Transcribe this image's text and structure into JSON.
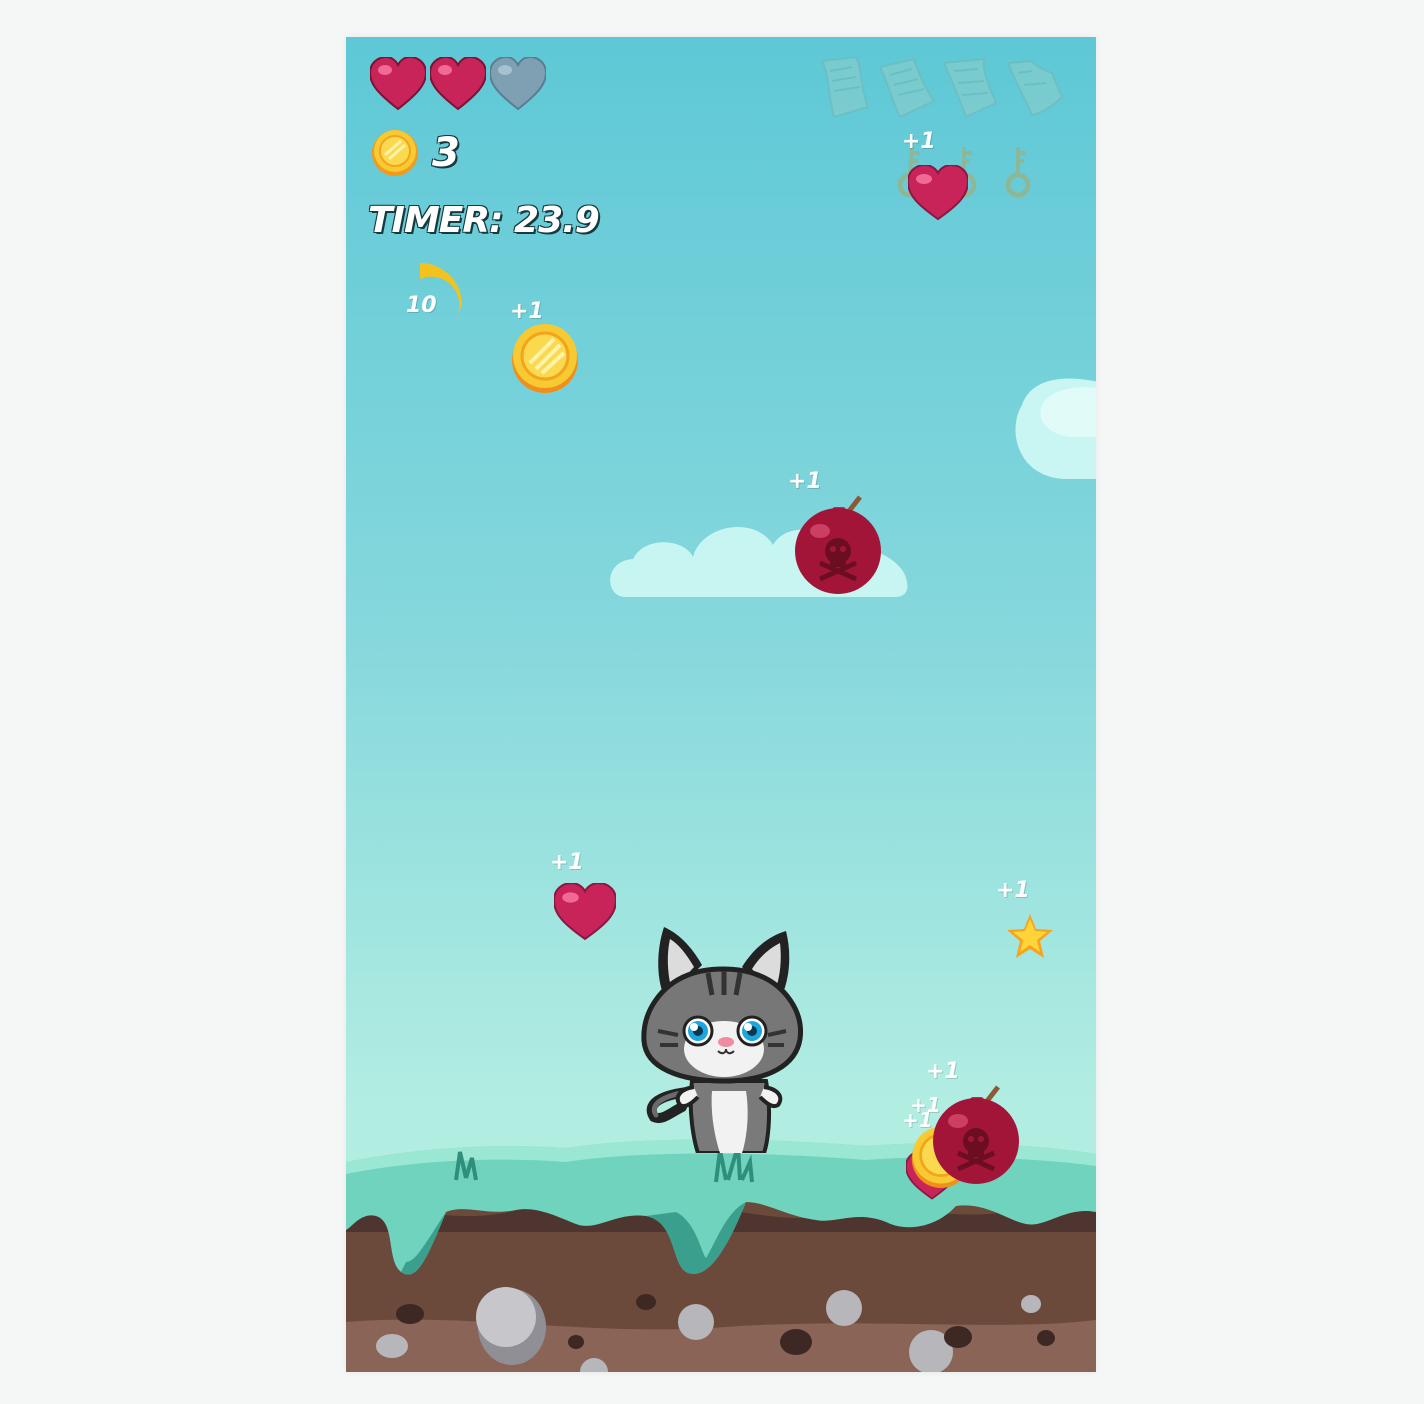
{
  "hud": {
    "lives": {
      "filled": 2,
      "total": 3,
      "filled_color": "#c8245a",
      "empty_color": "#7f9fb3"
    },
    "coins": {
      "icon": "coin-icon",
      "count": "3"
    },
    "timer": {
      "label": "TIMER: 23.9"
    },
    "powerup": {
      "value": "10",
      "color": "#f3c31c"
    },
    "scrolls": {
      "count": 4,
      "icon": "scroll-icon"
    },
    "keys": {
      "count": 3,
      "icon": "key-icon"
    }
  },
  "floaters": {
    "heart_top": "+1",
    "coin_mid": "+1",
    "bomb_mid": "+1",
    "heart_low": "+1",
    "star": "+1",
    "bomb_low": "+1",
    "coin_low_a": "+1",
    "coin_low_b": "+1"
  },
  "colors": {
    "sky_top": "#5ec8d6",
    "sky_bottom": "#b6efe4",
    "grass": "#6fd3bd",
    "dirt": "#6b4a3c",
    "bomb": "#a31538",
    "coin": "#f6b91f"
  }
}
